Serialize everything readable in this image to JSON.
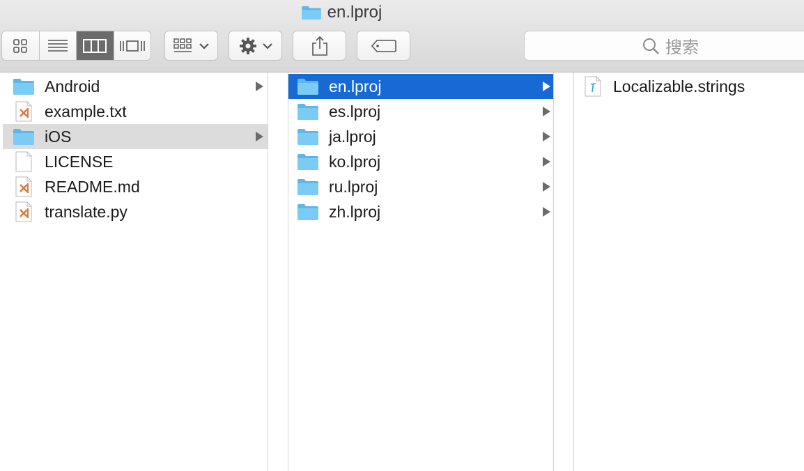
{
  "window": {
    "title": "en.lproj"
  },
  "toolbar": {
    "view_modes": [
      "icon-view",
      "list-view",
      "column-view",
      "cover-flow-view"
    ],
    "active_view": "column-view",
    "search_placeholder": "搜索"
  },
  "columns": [
    {
      "items": [
        {
          "name": "Android",
          "kind": "folder",
          "arrow": true,
          "selected": false
        },
        {
          "name": "example.txt",
          "kind": "code-file",
          "arrow": false,
          "selected": false
        },
        {
          "name": "iOS",
          "kind": "folder",
          "arrow": true,
          "selected": "inactive"
        },
        {
          "name": "LICENSE",
          "kind": "blank-file",
          "arrow": false,
          "selected": false
        },
        {
          "name": "README.md",
          "kind": "code-file",
          "arrow": false,
          "selected": false
        },
        {
          "name": "translate.py",
          "kind": "code-file",
          "arrow": false,
          "selected": false
        }
      ]
    },
    {
      "items": [
        {
          "name": "en.lproj",
          "kind": "folder",
          "arrow": true,
          "selected": "active"
        },
        {
          "name": "es.lproj",
          "kind": "folder",
          "arrow": true,
          "selected": false
        },
        {
          "name": "ja.lproj",
          "kind": "folder",
          "arrow": true,
          "selected": false
        },
        {
          "name": "ko.lproj",
          "kind": "folder",
          "arrow": true,
          "selected": false
        },
        {
          "name": "ru.lproj",
          "kind": "folder",
          "arrow": true,
          "selected": false
        },
        {
          "name": "zh.lproj",
          "kind": "folder",
          "arrow": true,
          "selected": false
        }
      ]
    },
    {
      "items": [
        {
          "name": "Localizable.strings",
          "kind": "strings-file",
          "arrow": false,
          "selected": false
        }
      ]
    }
  ],
  "colors": {
    "selection_active": "#1769d3",
    "selection_inactive": "#dcdcdc",
    "folder": "#6cc2f2",
    "code_file_accent": "#e0763a"
  }
}
